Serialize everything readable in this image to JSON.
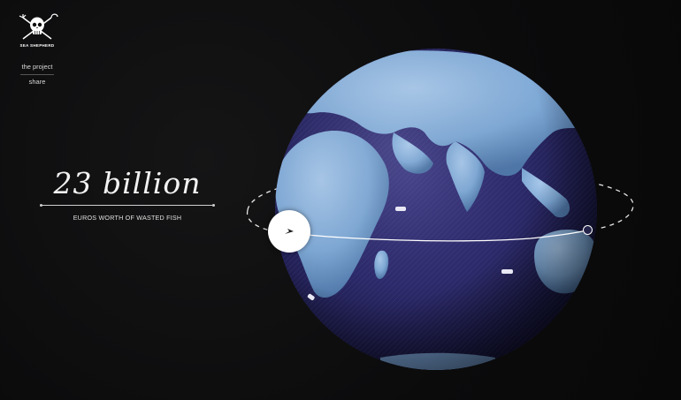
{
  "brand": {
    "logo_text": "SEA SHEPHERD",
    "logo_icon": "skull-crossed-trident-icon"
  },
  "nav": {
    "items": [
      {
        "label": "the project"
      },
      {
        "label": "share"
      }
    ]
  },
  "stat": {
    "value": "23 billion",
    "label": "EUROS WORTH OF WASTED FISH"
  },
  "globe": {
    "ocean_color": "#2c2a6a",
    "land_color": "#7fa9d6",
    "orbit_color": "#ffffff"
  },
  "colors": {
    "background": "#0b0b0c",
    "text": "#f2f2f2"
  }
}
